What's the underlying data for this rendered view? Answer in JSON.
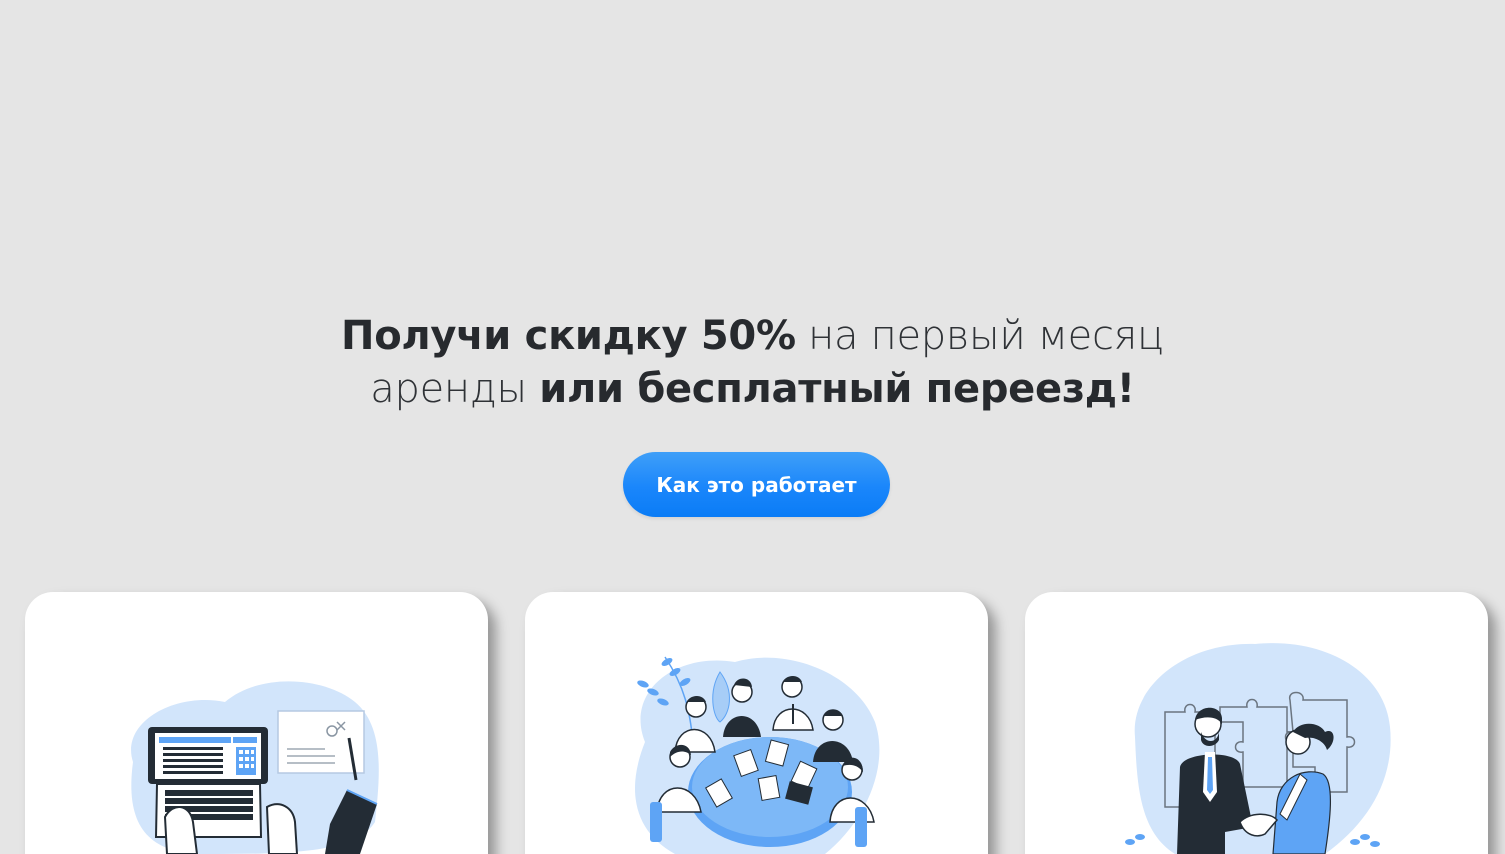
{
  "promo": {
    "line1_bold": "Получи скидку 50%",
    "line1_light": " на первый месяц",
    "line2_light": "аренды ",
    "line2_bold": "или бесплатный переезд!"
  },
  "cta": {
    "label": "Как это работает"
  },
  "cards": [
    {
      "illustration": "laptop-documents-illustration"
    },
    {
      "illustration": "team-meeting-illustration"
    },
    {
      "illustration": "handshake-puzzle-illustration"
    }
  ],
  "colors": {
    "background": "#e5e5e5",
    "accent": "#1a86fb",
    "text": "#272a2e",
    "illustration_blue": "#d2e5fb"
  }
}
